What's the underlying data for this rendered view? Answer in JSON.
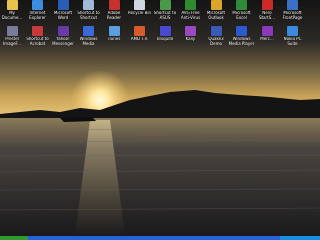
{
  "desktop": {
    "icons": [
      {
        "label": "My Docume...",
        "icon": "folder-icon",
        "color": "#e8c34a"
      },
      {
        "label": "Internet Explorer",
        "icon": "browser-icon",
        "color": "#3a8de0"
      },
      {
        "label": "Microsoft Word",
        "icon": "word-icon",
        "color": "#2b5cb8"
      },
      {
        "label": "Shortcut to Shortcut",
        "icon": "shortcut-icon",
        "color": "#9fb7d8"
      },
      {
        "label": "Adobe Reader",
        "icon": "pdf-icon",
        "color": "#c83030"
      },
      {
        "label": "Recycle Bin",
        "icon": "recycle-bin-icon",
        "color": "#cfd8e0"
      },
      {
        "label": "Shortcut to ASUS",
        "icon": "shortcut-icon",
        "color": "#4a9a4a"
      },
      {
        "label": "AVG Free Anti-Virus",
        "icon": "antivirus-icon",
        "color": "#2e8b2e"
      },
      {
        "label": "Microsoft Outlook",
        "icon": "outlook-icon",
        "color": "#d9a62a"
      },
      {
        "label": "Microsoft Excel",
        "icon": "excel-icon",
        "color": "#2f8a3a"
      },
      {
        "label": "Nero StartS...",
        "icon": "nero-icon",
        "color": "#cc2a2a"
      },
      {
        "label": "Microsoft FrontPage",
        "icon": "frontpage-icon",
        "color": "#3a70c8"
      },
      {
        "label": "Prestel ImageF...",
        "icon": "image-icon",
        "color": "#7a7a9a"
      },
      {
        "label": "Shortcut to Acrobat",
        "icon": "acrobat-icon",
        "color": "#c83a3a"
      },
      {
        "label": "Yahoo! Messenger",
        "icon": "messenger-icon",
        "color": "#6a3aa8"
      },
      {
        "label": "Windows Media",
        "icon": "media-icon",
        "color": "#3a6ad8"
      },
      {
        "label": "iTunes",
        "icon": "itunes-icon",
        "color": "#5aa0e0"
      },
      {
        "label": "AMD T.V.",
        "icon": "tv-icon",
        "color": "#d85a2a"
      },
      {
        "label": "Uniquite",
        "icon": "app-icon",
        "color": "#4a4ad0"
      },
      {
        "label": "Kanji",
        "icon": "app-icon",
        "color": "#9a4ac0"
      },
      {
        "label": "Quake3 Demo",
        "icon": "game-icon",
        "color": "#3a5ab8"
      },
      {
        "label": "Windows Media Player",
        "icon": "media-player-icon",
        "color": "#2a5ad0"
      },
      {
        "label": "Merc...",
        "icon": "app-icon",
        "color": "#8a3ab8"
      },
      {
        "label": "Nokia PC Suite",
        "icon": "phone-icon",
        "color": "#3a8ae0"
      }
    ]
  },
  "taskbar": {
    "start_color": "#2f9a2f",
    "bar_color": "#2563d6",
    "tray_color": "#1790e4"
  }
}
